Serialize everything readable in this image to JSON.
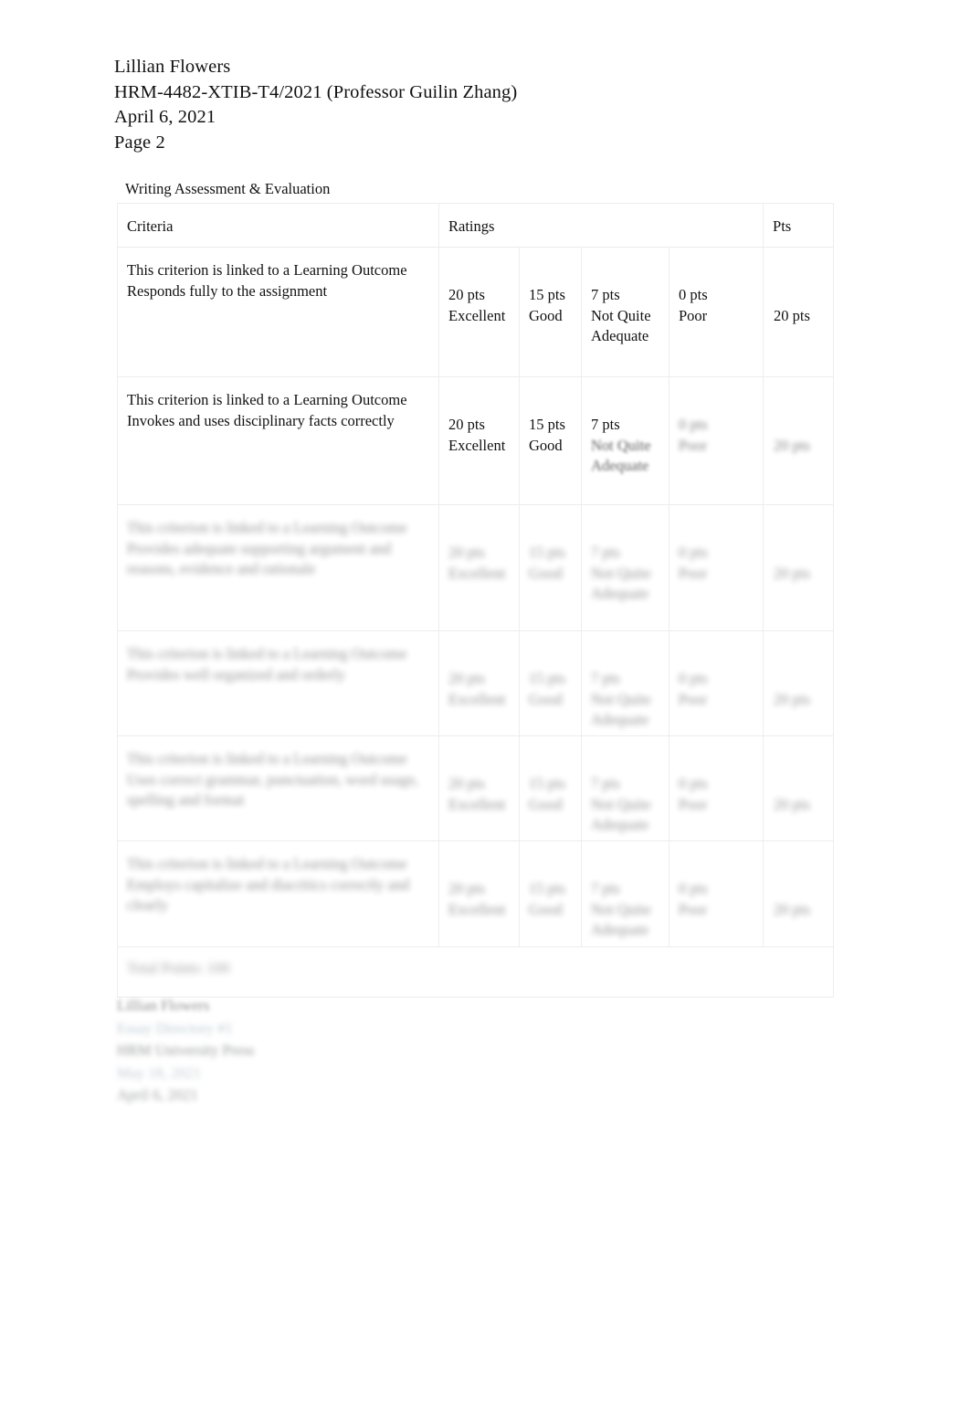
{
  "document": {
    "header": {
      "student_name": "Lillian Flowers",
      "course": "HRM-4482-XTIB-T4/2021 (Professor Guilin Zhang)",
      "date": "April 6, 2021",
      "page": "Page 2"
    },
    "rubric_title": "Writing Assessment & Evaluation"
  },
  "table": {
    "columns": [
      "Criteria",
      "Ratings",
      "Pts"
    ],
    "rows": [
      {
        "criteria": "This criterion is linked to a Learning Outcome Responds fully to the assignment",
        "ratings": [
          {
            "points": "20 pts",
            "label": "Excellent"
          },
          {
            "points": "15 pts",
            "label": "Good"
          },
          {
            "points": "7 pts",
            "label": "Not Quite Adequate"
          },
          {
            "points": "0 pts",
            "label": "Poor"
          }
        ],
        "pts": "20 pts",
        "blur": "none"
      },
      {
        "criteria": "This criterion is linked to a Learning Outcome Invokes and uses disciplinary facts correctly",
        "ratings": [
          {
            "points": "20 pts",
            "label": "Excellent"
          },
          {
            "points": "15 pts",
            "label": "Good"
          },
          {
            "points": "7 pts",
            "label": "Not Quite Adequate"
          },
          {
            "points": "0 pts",
            "label": "Poor"
          }
        ],
        "pts": "20 pts",
        "blur": "partial"
      },
      {
        "criteria": "This criterion is linked to a Learning Outcome Provides adequate supporting argument and reasons, evidence and rationale",
        "ratings": [
          {
            "points": "20 pts",
            "label": "Excellent"
          },
          {
            "points": "15 pts",
            "label": "Good"
          },
          {
            "points": "7 pts",
            "label": "Not Quite Adequate"
          },
          {
            "points": "0 pts",
            "label": "Poor"
          }
        ],
        "pts": "20 pts",
        "blur": "full"
      },
      {
        "criteria": "This criterion is linked to a Learning Outcome Provides well organized and orderly",
        "ratings": [
          {
            "points": "20 pts",
            "label": "Excellent"
          },
          {
            "points": "15 pts",
            "label": "Good"
          },
          {
            "points": "7 pts",
            "label": "Not Quite Adequate"
          },
          {
            "points": "0 pts",
            "label": "Poor"
          }
        ],
        "pts": "20 pts",
        "blur": "full"
      },
      {
        "criteria": "This criterion is linked to a Learning Outcome Uses correct grammar, punctuation, word usage, spelling and format",
        "ratings": [
          {
            "points": "20 pts",
            "label": "Excellent"
          },
          {
            "points": "15 pts",
            "label": "Good"
          },
          {
            "points": "7 pts",
            "label": "Not Quite Adequate"
          },
          {
            "points": "0 pts",
            "label": "Poor"
          }
        ],
        "pts": "20 pts",
        "blur": "full"
      },
      {
        "criteria": "This criterion is linked to a Learning Outcome Employs capitalize and diacritics correctly and clearly",
        "ratings": [
          {
            "points": "20 pts",
            "label": "Excellent"
          },
          {
            "points": "15 pts",
            "label": "Good"
          },
          {
            "points": "7 pts",
            "label": "Not Quite Adequate"
          },
          {
            "points": "0 pts",
            "label": "Poor"
          }
        ],
        "pts": "20 pts",
        "blur": "full"
      }
    ],
    "total_row": "Total Points: 100"
  },
  "footer": {
    "lines": [
      "Lillian Flowers",
      "Essay Directory #1",
      "HRM University Press",
      "May 18, 2021",
      "April 6, 2021"
    ]
  }
}
